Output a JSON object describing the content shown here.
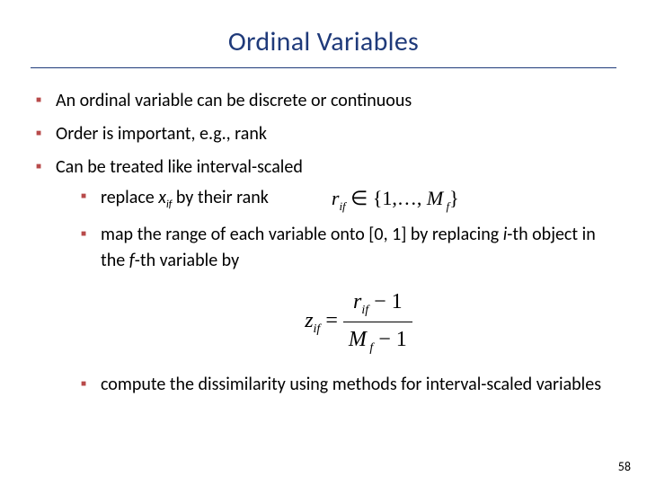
{
  "title": "Ordinal Variables",
  "bullets": {
    "b1": "An ordinal variable can be discrete or continuous",
    "b2": "Order is important, e.g., rank",
    "b3": "Can be treated like interval-scaled",
    "s1_pre": "replace ",
    "s1_var": "x",
    "s1_sub": "if",
    "s1_post": "  by their rank",
    "s2_a": "map the range of each variable onto [0, 1] by replacing ",
    "s2_i": "i",
    "s2_b": "-th object in the ",
    "s2_f": "f",
    "s2_c": "-th variable by",
    "s3": "compute the dissimilarity using methods for interval-scaled variables"
  },
  "math": {
    "r": "r",
    "r_sub": "if",
    "in": " ∈ ",
    "set_open": "{1,…, ",
    "M": "M",
    "M_sub": " f",
    "set_close": "}",
    "z": "z",
    "z_sub": "if",
    "eq": " = ",
    "num_r": "r",
    "num_r_sub": "if",
    "num_tail": " − 1",
    "den_M": "M",
    "den_M_sub": " f",
    "den_tail": " − 1"
  },
  "page": "58"
}
